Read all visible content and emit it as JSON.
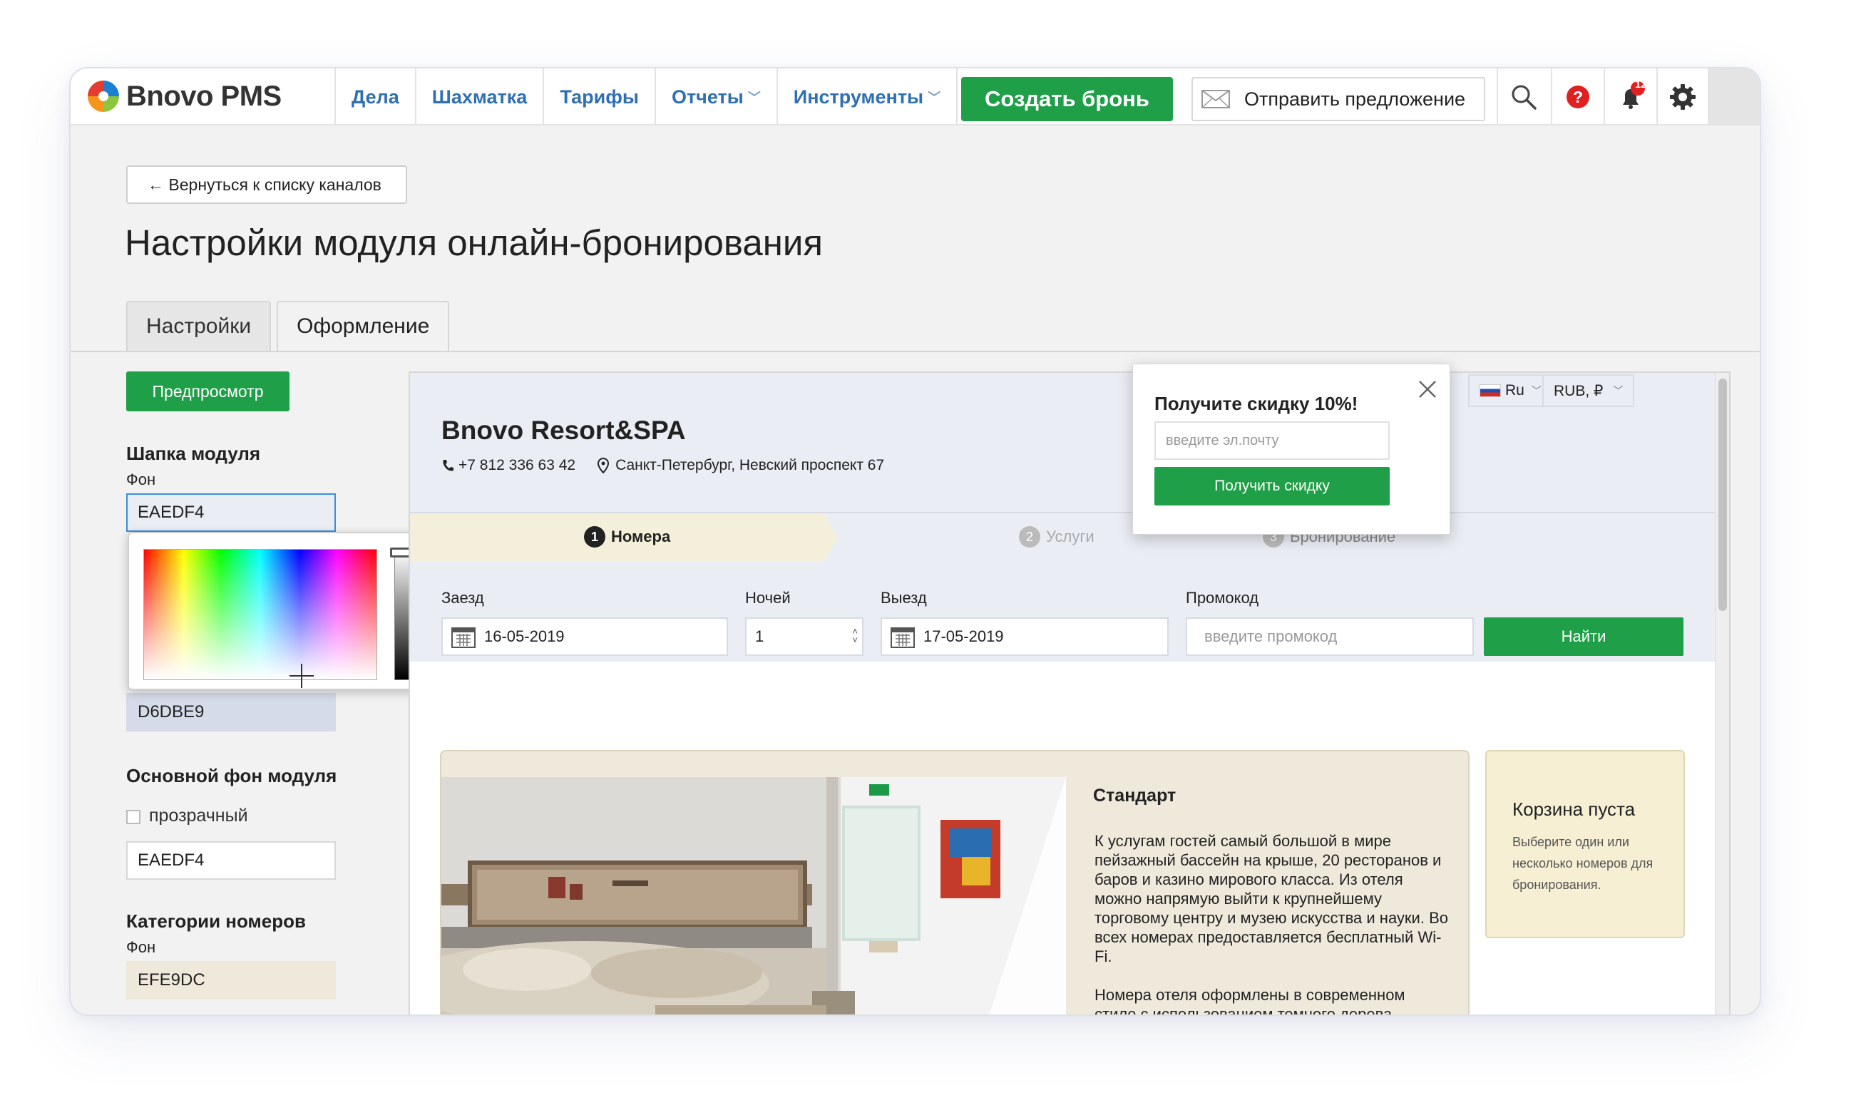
{
  "app": {
    "logo_text": "Bnovo PMS"
  },
  "nav": {
    "items": [
      {
        "label": "Дела",
        "has_menu": false
      },
      {
        "label": "Шахматка",
        "has_menu": false
      },
      {
        "label": "Тарифы",
        "has_menu": false
      },
      {
        "label": "Отчеты",
        "has_menu": true
      },
      {
        "label": "Инструменты",
        "has_menu": true
      }
    ],
    "create_button": "Создать бронь",
    "offer_button": "Отправить предложение",
    "notifications_count": "12",
    "tools": [
      "search-icon",
      "help-icon",
      "bell-icon",
      "gear-icon"
    ]
  },
  "page": {
    "back_button": "← Вернуться к списку каналов",
    "title": "Настройки модуля онлайн-бронирования",
    "tabs": [
      {
        "label": "Настройки",
        "active": false
      },
      {
        "label": "Оформление",
        "active": true
      }
    ]
  },
  "left_panel": {
    "preview_button": "Предпросмотр",
    "header_section": {
      "title": "Шапка модуля",
      "bg_label": "Фон",
      "bg_value": "EAEDF4",
      "second_value": "D6DBE9"
    },
    "main_bg_section": {
      "title": "Основной фон модуля",
      "transparent_label": "прозрачный",
      "transparent_checked": false,
      "value": "EAEDF4"
    },
    "rooms_section": {
      "title": "Категории номеров",
      "bg_label": "Фон",
      "bg_value": "EFE9DC"
    }
  },
  "preview": {
    "hotel_name": "Bnovo Resort&SPA",
    "phone": "+7 812 336 63 42",
    "address": "Санкт-Петербург, Невский проспект 67",
    "lang": "Ru",
    "currency": "RUB, ₽",
    "steps": [
      {
        "num": "1",
        "label": "Номера",
        "active": true
      },
      {
        "num": "2",
        "label": "Услуги",
        "active": false
      },
      {
        "num": "3",
        "label": "Бронирование",
        "active": false
      }
    ],
    "search": {
      "checkin_label": "Заезд",
      "checkin_value": "16-05-2019",
      "nights_label": "Ночей",
      "nights_value": "1",
      "checkout_label": "Выезд",
      "checkout_value": "17-05-2019",
      "promo_label": "Промокод",
      "promo_placeholder": "введите промокод",
      "find_button": "Найти"
    },
    "room": {
      "title": "Стандарт",
      "description_1": "К услугам гостей самый большой в мире пейзажный бассейн на крыше, 20 ресторанов и баров и казино мирового класса. Из отеля можно напрямую выйти к крупнейшему торговому центру и музею искусства и науки. Во всех номерах предоставляется бесплатный Wi-Fi.",
      "description_2": "Номера отеля оформлены в современном стиле с использованием темного дерева,"
    },
    "cart": {
      "title": "Корзина пуста",
      "text": "Выберите один или несколько номеров для бронирования."
    },
    "popup": {
      "title": "Получите скидку 10%!",
      "email_placeholder": "введите эл.почту",
      "button": "Получить скидку"
    }
  },
  "colors": {
    "accent_green": "#1fa048",
    "nav_blue": "#2f6fb3",
    "header_bg": "#eaedf4",
    "room_bg": "#efe9dc",
    "cart_bg": "#f6efd3",
    "step_active_bg": "#f4efda"
  }
}
